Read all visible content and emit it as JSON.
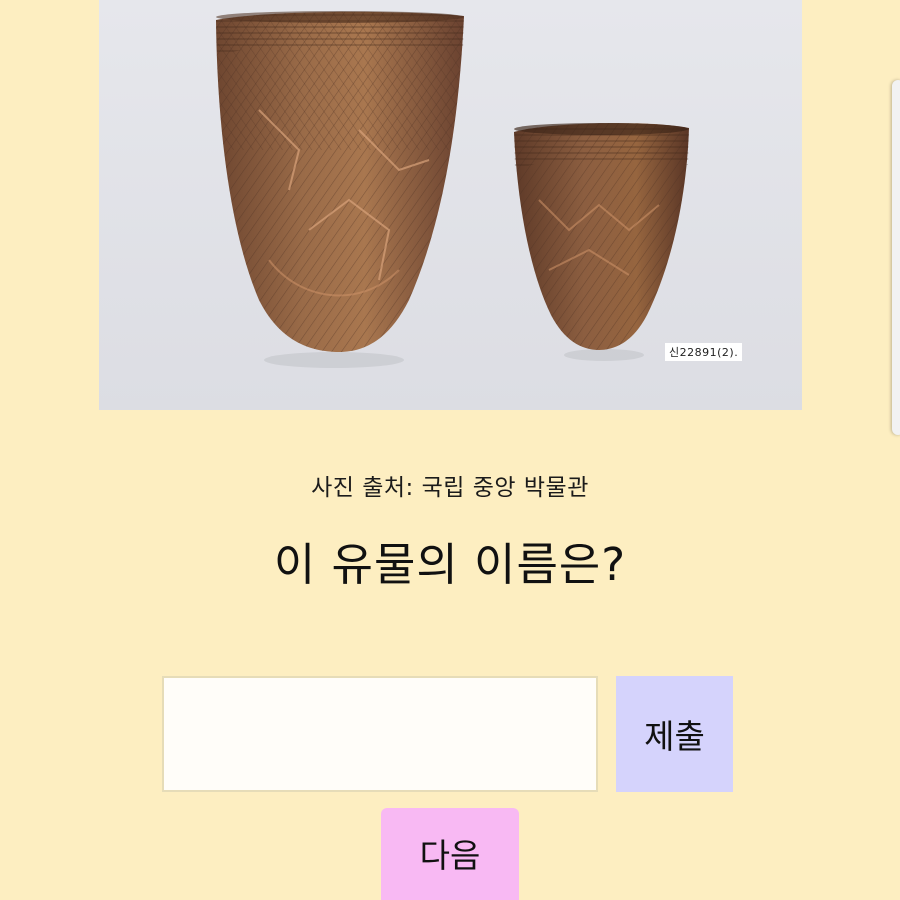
{
  "artifact_image": {
    "catalog_label": "신22891(2)."
  },
  "caption": "사진 출처: 국립 중앙 박물관",
  "question": "이 유물의 이름은?",
  "answer_input": {
    "value": "",
    "placeholder": ""
  },
  "buttons": {
    "submit_label": "제출",
    "next_label": "다음"
  },
  "colors": {
    "background": "#fdeec1",
    "submit_button": "#d5d3fc",
    "next_button": "#f8b9f3",
    "pottery": "#8a5a3a"
  }
}
